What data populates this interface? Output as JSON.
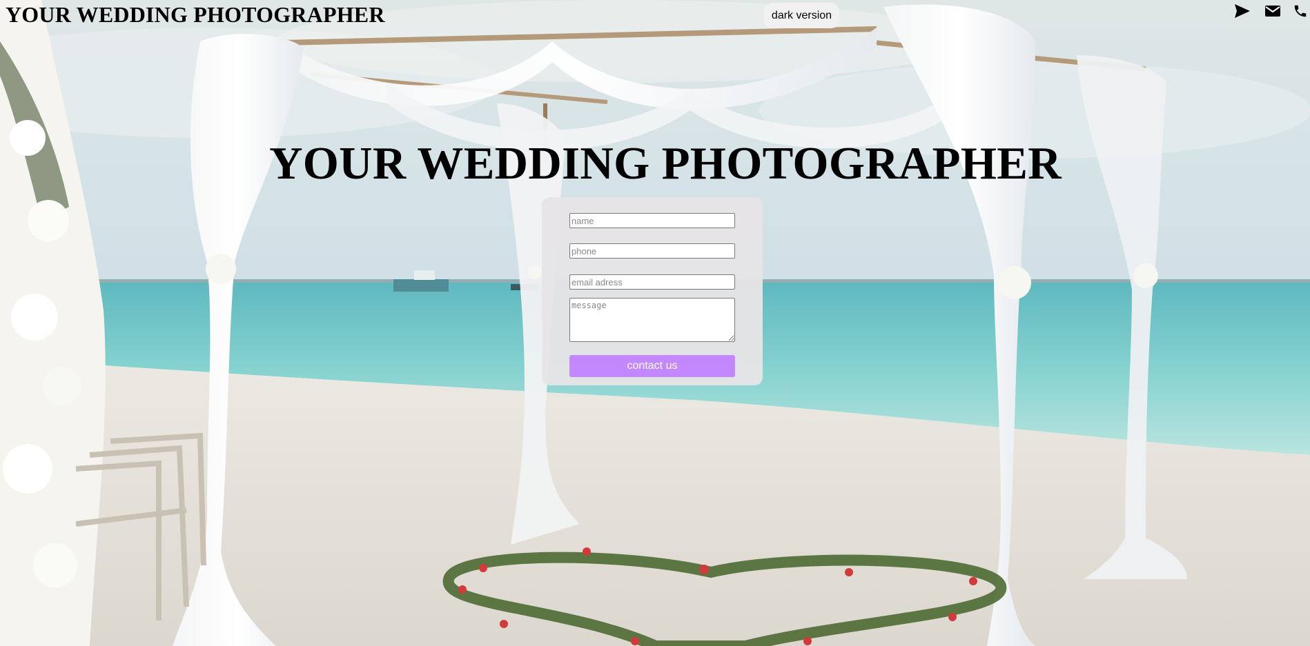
{
  "header": {
    "site_title": "YOUR WEDDING PHOTOGRAPHER",
    "dark_toggle_label": "dark version",
    "icons": [
      "send-icon",
      "mail-icon",
      "phone-icon"
    ]
  },
  "hero": {
    "title": "YOUR WEDDING PHOTOGRAPHER"
  },
  "form": {
    "name_placeholder": "name",
    "phone_placeholder": "phone",
    "email_placeholder": "email adress",
    "message_placeholder": "message",
    "submit_label": "contact us"
  },
  "colors": {
    "button_accent": "#c387fe",
    "card_background": "#e6e4e6"
  }
}
